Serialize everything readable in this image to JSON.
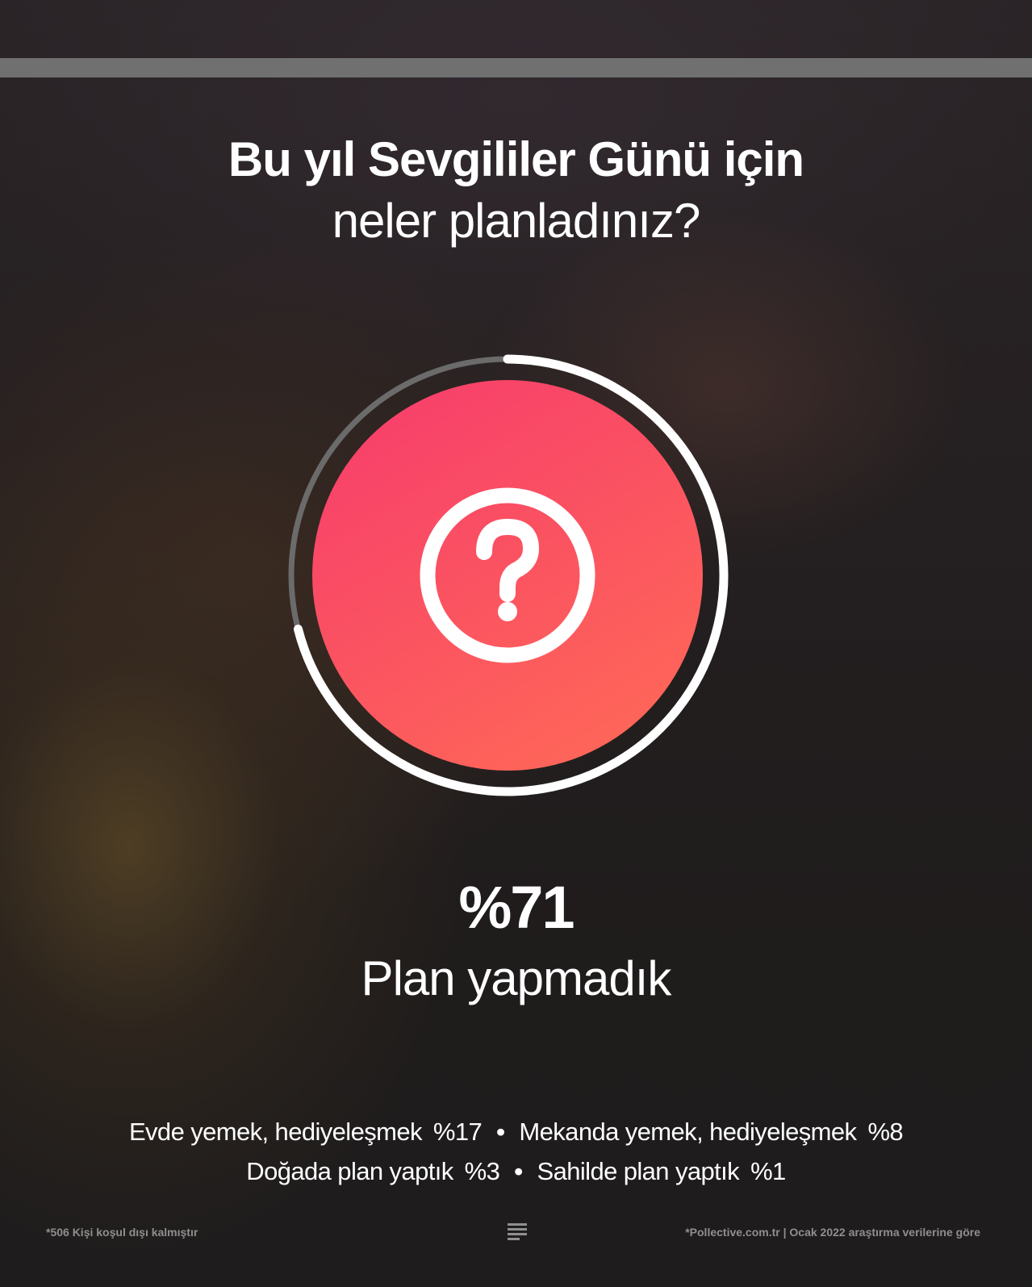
{
  "header": {
    "progress_fill": 1.0
  },
  "title": {
    "line1": "Bu yıl Sevgililer Günü için",
    "line2": "neler planladınız?"
  },
  "highlight": {
    "value_label": "%71",
    "caption": "Plan yapmadık",
    "icon": "question-circle-icon"
  },
  "others": {
    "row1": [
      {
        "label": "Evde yemek, hediyeleşmek",
        "value": "%17"
      },
      {
        "label": "Mekanda yemek, hediyeleşmek",
        "value": "%8"
      }
    ],
    "row2": [
      {
        "label": "Doğada plan yaptık",
        "value": "%3"
      },
      {
        "label": "Sahilde plan yaptık",
        "value": "%1"
      }
    ],
    "separator": "•"
  },
  "footer": {
    "left_note": "*506 Kişi koşul dışı kalmıştır",
    "right_note": "*Pollective.com.tr | Ocak 2022 araştırma verilerine göre",
    "menu_icon": "menu-lines-icon"
  },
  "colors": {
    "gradient_start": "#f73f6b",
    "gradient_end": "#ff6857",
    "ring_fill": "#ffffff",
    "ring_track": "#6b6b6b"
  },
  "chart_data": {
    "type": "pie",
    "title": "Bu yıl Sevgililer Günü için neler planladınız?",
    "categories": [
      "Plan yapmadık",
      "Evde yemek, hediyeleşmek",
      "Mekanda yemek, hediyeleşmek",
      "Doğada plan yaptık",
      "Sahilde plan yaptık"
    ],
    "values": [
      71,
      17,
      8,
      3,
      1
    ],
    "unit": "%",
    "highlighted": "Plan yapmadık"
  }
}
